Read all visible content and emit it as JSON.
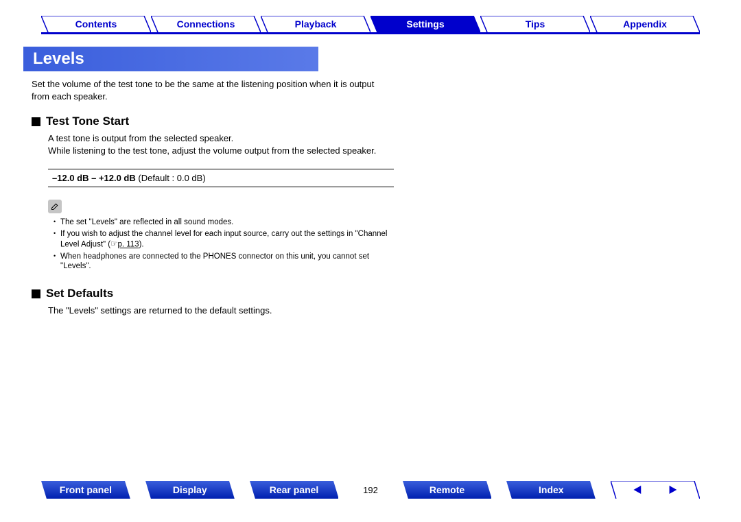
{
  "topNav": {
    "items": [
      {
        "label": "Contents",
        "active": false
      },
      {
        "label": "Connections",
        "active": false
      },
      {
        "label": "Playback",
        "active": false
      },
      {
        "label": "Settings",
        "active": true
      },
      {
        "label": "Tips",
        "active": false
      },
      {
        "label": "Appendix",
        "active": false
      }
    ]
  },
  "section": {
    "title": "Levels"
  },
  "intro": "Set the volume of the test tone to be the same at the listening position when it is output from each speaker.",
  "testTone": {
    "title": "Test Tone Start",
    "body1": "A test tone is output from the selected speaker.",
    "body2": "While listening to the test tone, adjust the volume output from the selected speaker.",
    "rangeBold": "–12.0 dB – +12.0 dB",
    "rangeDefault": " (Default : 0.0 dB)"
  },
  "notes": {
    "n1": "The set \"Levels\" are reflected in all sound modes.",
    "n2a": "If you wish to adjust the channel level for each input source, carry out the settings in \"Channel Level Adjust\" (",
    "n2link": "p. 113",
    "n2b": ").",
    "n3": "When headphones are connected to the PHONES connector on this unit, you cannot set \"Levels\"."
  },
  "setDefaults": {
    "title": "Set Defaults",
    "body": "The \"Levels\" settings are returned to the default settings."
  },
  "bottomNav": {
    "items": [
      {
        "label": "Front panel"
      },
      {
        "label": "Display"
      },
      {
        "label": "Rear panel"
      }
    ],
    "pageNum": "192",
    "items2": [
      {
        "label": "Remote"
      },
      {
        "label": "Index"
      }
    ]
  }
}
